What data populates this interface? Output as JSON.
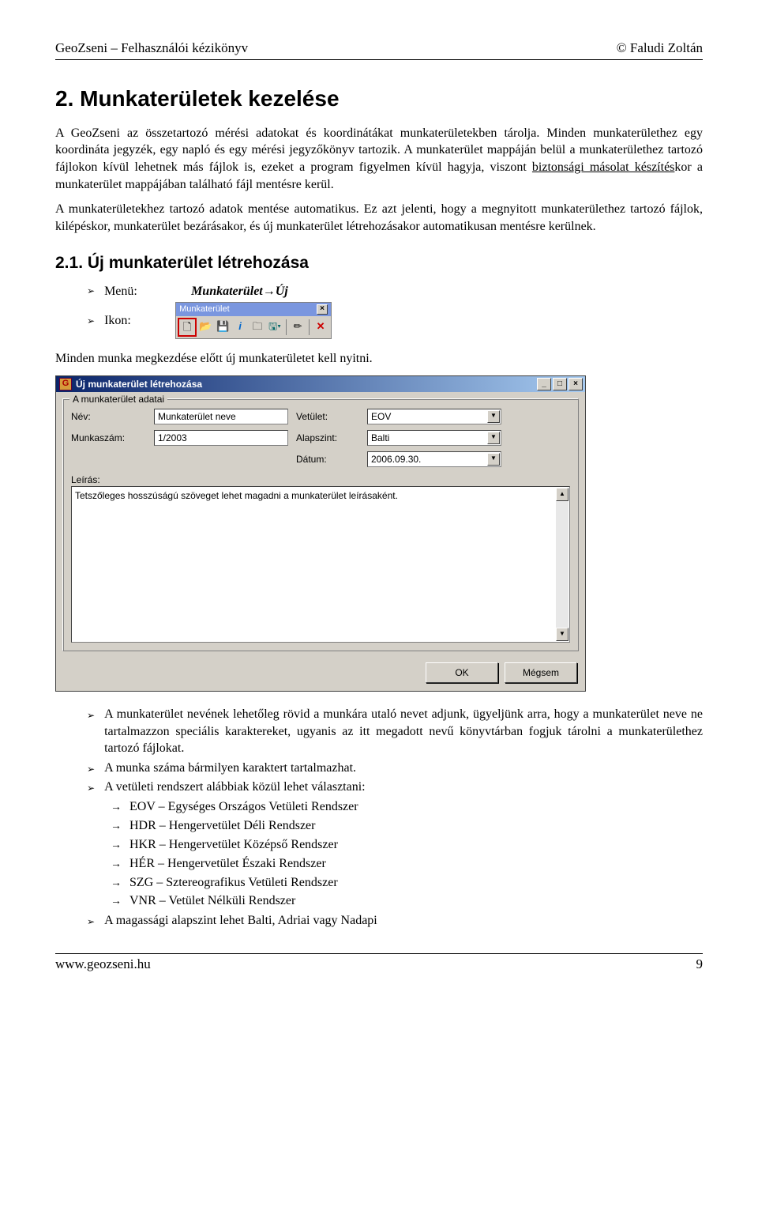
{
  "header": {
    "left": "GeoZseni – Felhasználói kézikönyv",
    "right": "© Faludi Zoltán"
  },
  "h1": "2.  Munkaterületek kezelése",
  "p1": "A GeoZseni az összetartozó mérési adatokat és koordinátákat munkaterületekben tárolja. Minden munkaterülethez egy koordináta jegyzék, egy napló és egy mérési jegyzőkönyv tartozik. A munkaterület mappáján belül a munkaterülethez tartozó fájlokon kívül lehetnek más fájlok is, ezeket a program figyelmen kívül hagyja, viszont ",
  "p1_link": "biztonsági másolat készítés",
  "p1_tail": "kor a munkaterület mappájában található fájl mentésre kerül.",
  "p2": "A munkaterületekhez tartozó adatok mentése automatikus. Ez azt jelenti, hogy a megnyitott munkaterülethez tartozó fájlok, kilépéskor, munkaterület bezárásakor, és új munkaterület létrehozásakor automatikusan mentésre kerülnek.",
  "h2": "2.1.   Új munkaterület létrehozása",
  "menu": {
    "label": "Menü:",
    "value": "Munkaterület→Új"
  },
  "ikon": {
    "label": "Ikon:"
  },
  "toolbar": {
    "title": "Munkaterület"
  },
  "p3": "Minden munka megkezdése előtt új munkaterületet kell nyitni.",
  "dialog": {
    "title": "Új munkaterület létrehozása",
    "group": "A munkaterület adatai",
    "labels": {
      "nev": "Név:",
      "vetulet": "Vetület:",
      "munkaszam": "Munkaszám:",
      "alapszint": "Alapszint:",
      "leiras": "Leírás:",
      "datum": "Dátum:"
    },
    "values": {
      "nev": "Munkaterület neve",
      "vetulet": "EOV",
      "munkaszam": "1/2003",
      "alapszint": "Balti",
      "datum": "2006.09.30."
    },
    "description": "Tetszőleges hosszúságú szöveget lehet magadni a munkaterület leírásaként.",
    "ok": "OK",
    "cancel": "Mégsem"
  },
  "bullets": {
    "b1": "A munkaterület nevének lehetőleg rövid a munkára utaló nevet adjunk, ügyeljünk arra, hogy a munkaterület neve ne tartalmazzon speciális karaktereket, ugyanis az itt megadott nevű könyvtárban fogjuk tárolni a munkaterülethez tartozó fájlokat.",
    "b2": "A munka száma bármilyen karaktert tartalmazhat.",
    "b3": "A vetületi rendszert alábbiak közül lehet választani:",
    "sub": [
      "EOV – Egységes Országos Vetületi Rendszer",
      "HDR – Hengervetület Déli Rendszer",
      "HKR – Hengervetület Középső Rendszer",
      "HÉR – Hengervetület Északi Rendszer",
      "SZG – Sztereografikus Vetületi Rendszer",
      "VNR – Vetület Nélküli Rendszer"
    ],
    "b4": "A magassági alapszint lehet Balti, Adriai vagy Nadapi"
  },
  "footer": {
    "left": "www.geozseni.hu",
    "right": "9"
  }
}
